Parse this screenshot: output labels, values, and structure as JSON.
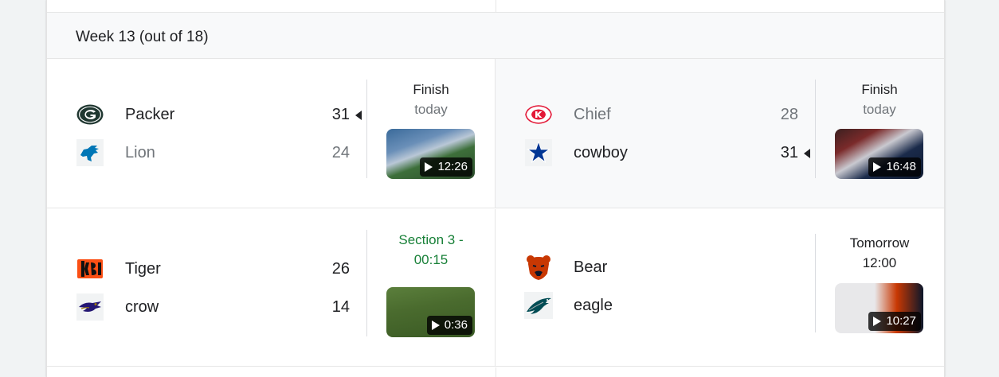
{
  "week_label": "Week 13 (out of 18)",
  "games": [
    {
      "home": {
        "name": "Packer",
        "score": "31",
        "logo": "packers-logo-icon",
        "winner": true
      },
      "away": {
        "name": "Lion",
        "score": "24",
        "logo": "lions-logo-icon",
        "winner": false
      },
      "status": {
        "line1": "Finish",
        "line2": "today"
      },
      "video": {
        "duration": "12:26"
      }
    },
    {
      "home": {
        "name": "Chief",
        "score": "28",
        "logo": "chiefs-logo-icon",
        "winner": false
      },
      "away": {
        "name": "cowboy",
        "score": "31",
        "logo": "cowboys-logo-icon",
        "winner": true
      },
      "status": {
        "line1": "Finish",
        "line2": "today"
      },
      "video": {
        "duration": "16:48"
      }
    },
    {
      "home": {
        "name": "Tiger",
        "score": "26",
        "logo": "bengals-logo-icon"
      },
      "away": {
        "name": "crow",
        "score": "14",
        "logo": "ravens-logo-icon"
      },
      "status": {
        "line1": "Section 3 -",
        "line2": "00:15"
      },
      "video": {
        "duration": "0:36"
      }
    },
    {
      "home": {
        "name": "Bear",
        "logo": "bears-logo-icon"
      },
      "away": {
        "name": "eagle",
        "logo": "eagles-logo-icon"
      },
      "status": {
        "line1": "Tomorrow",
        "line2": "12:00"
      },
      "video": {
        "duration": "10:27"
      }
    }
  ],
  "colors": {
    "live": "#188038",
    "muted": "#70757a",
    "text": "#202124"
  }
}
